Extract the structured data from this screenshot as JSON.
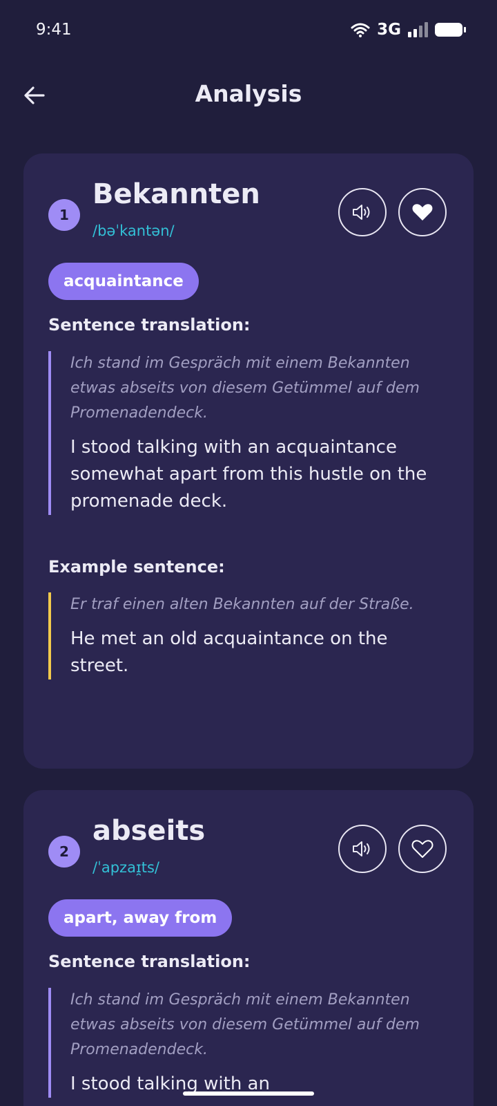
{
  "status_bar": {
    "time": "9:41",
    "network": "3G"
  },
  "header": {
    "title": "Analysis"
  },
  "colors": {
    "background": "#201e3c",
    "card": "#2b2650",
    "accent": "#8c75f0",
    "phonetic": "#33c0d6",
    "example_bar": "#f2c94c"
  },
  "icons": {
    "back": "arrow-left-icon",
    "audio": "speaker-icon",
    "favorite_filled": "heart-filled-icon",
    "favorite_outline": "heart-outline-icon"
  },
  "cards": [
    {
      "number": "1",
      "word": "Bekannten",
      "phonetic": "/bəˈkantən/",
      "meaning": "acquaintance",
      "favorited": true,
      "sentence_label": "Sentence translation:",
      "sentence_source": "Ich stand im Gespräch mit einem Bekannten etwas abseits von diesem Getümmel auf dem Promenadendeck.",
      "sentence_translation": "I stood talking with an acquaintance somewhat apart from this hustle on the promenade deck.",
      "example_label": "Example sentence:",
      "example_source": "Er traf einen alten Bekannten auf der Straße.",
      "example_translation": "He met an old acquaintance on the street."
    },
    {
      "number": "2",
      "word": "abseits",
      "phonetic": "/ˈapzaɪ̯ts/",
      "meaning": "apart, away from",
      "favorited": false,
      "sentence_label": "Sentence translation:",
      "sentence_source": "Ich stand im Gespräch mit einem Bekannten etwas abseits von diesem Getümmel auf dem Promenadendeck.",
      "sentence_translation": "I stood talking with an"
    }
  ]
}
